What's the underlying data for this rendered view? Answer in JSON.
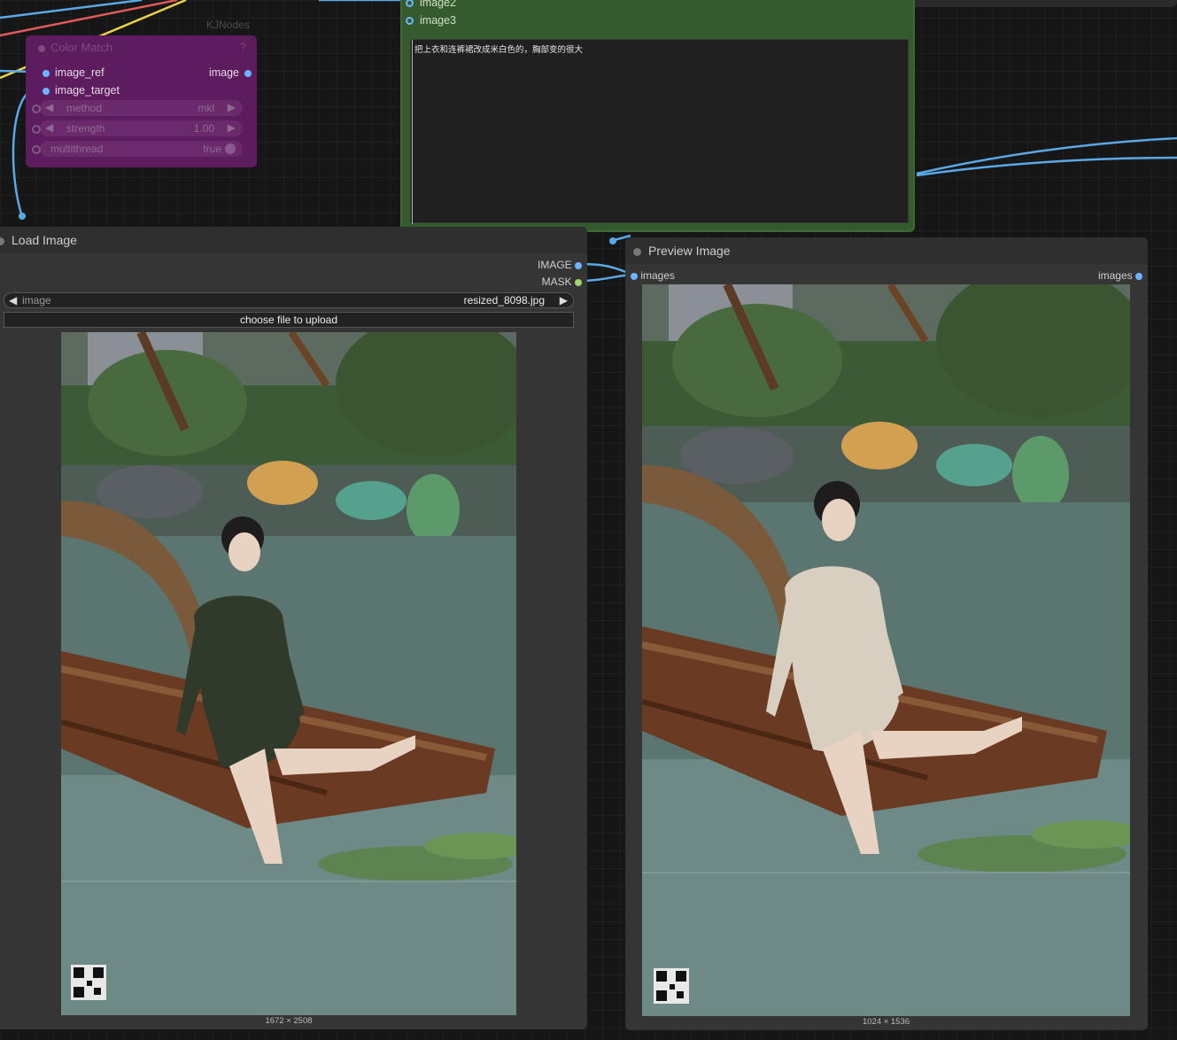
{
  "color_match": {
    "title": "Color Match",
    "tag": "KJNodes",
    "help": "?",
    "inputs": {
      "image_ref": "image_ref",
      "image_target": "image_target"
    },
    "output": "image",
    "widgets": [
      {
        "name": "method",
        "value": "mkl"
      },
      {
        "name": "strength",
        "value": "1.00"
      },
      {
        "name": "multithread",
        "value": "true"
      }
    ]
  },
  "text_node": {
    "inputs": [
      "image2",
      "image3"
    ],
    "prompt": "把上衣和连裤裙改成米白色的，胸部变的很大"
  },
  "load_image": {
    "title": "Load Image",
    "outputs": [
      "IMAGE",
      "MASK"
    ],
    "image_widget": {
      "name": "image",
      "value": "resized_8098.jpg"
    },
    "upload_label": "choose file to upload",
    "dimensions": "1672 × 2508",
    "dress_color": "#2f3a2a"
  },
  "preview_image": {
    "title": "Preview Image",
    "input": "images",
    "output": "images",
    "dimensions": "1024 × 1536",
    "dress_color": "#d9cfc1"
  },
  "colors": {
    "canvas": "#161616",
    "wire_blue": "#5aa9e6",
    "wire_yellow": "#e8d24a",
    "wire_red": "#e05a5a",
    "color_match_bg": "#5c1c5e",
    "text_node_bg": "#355a2d"
  }
}
